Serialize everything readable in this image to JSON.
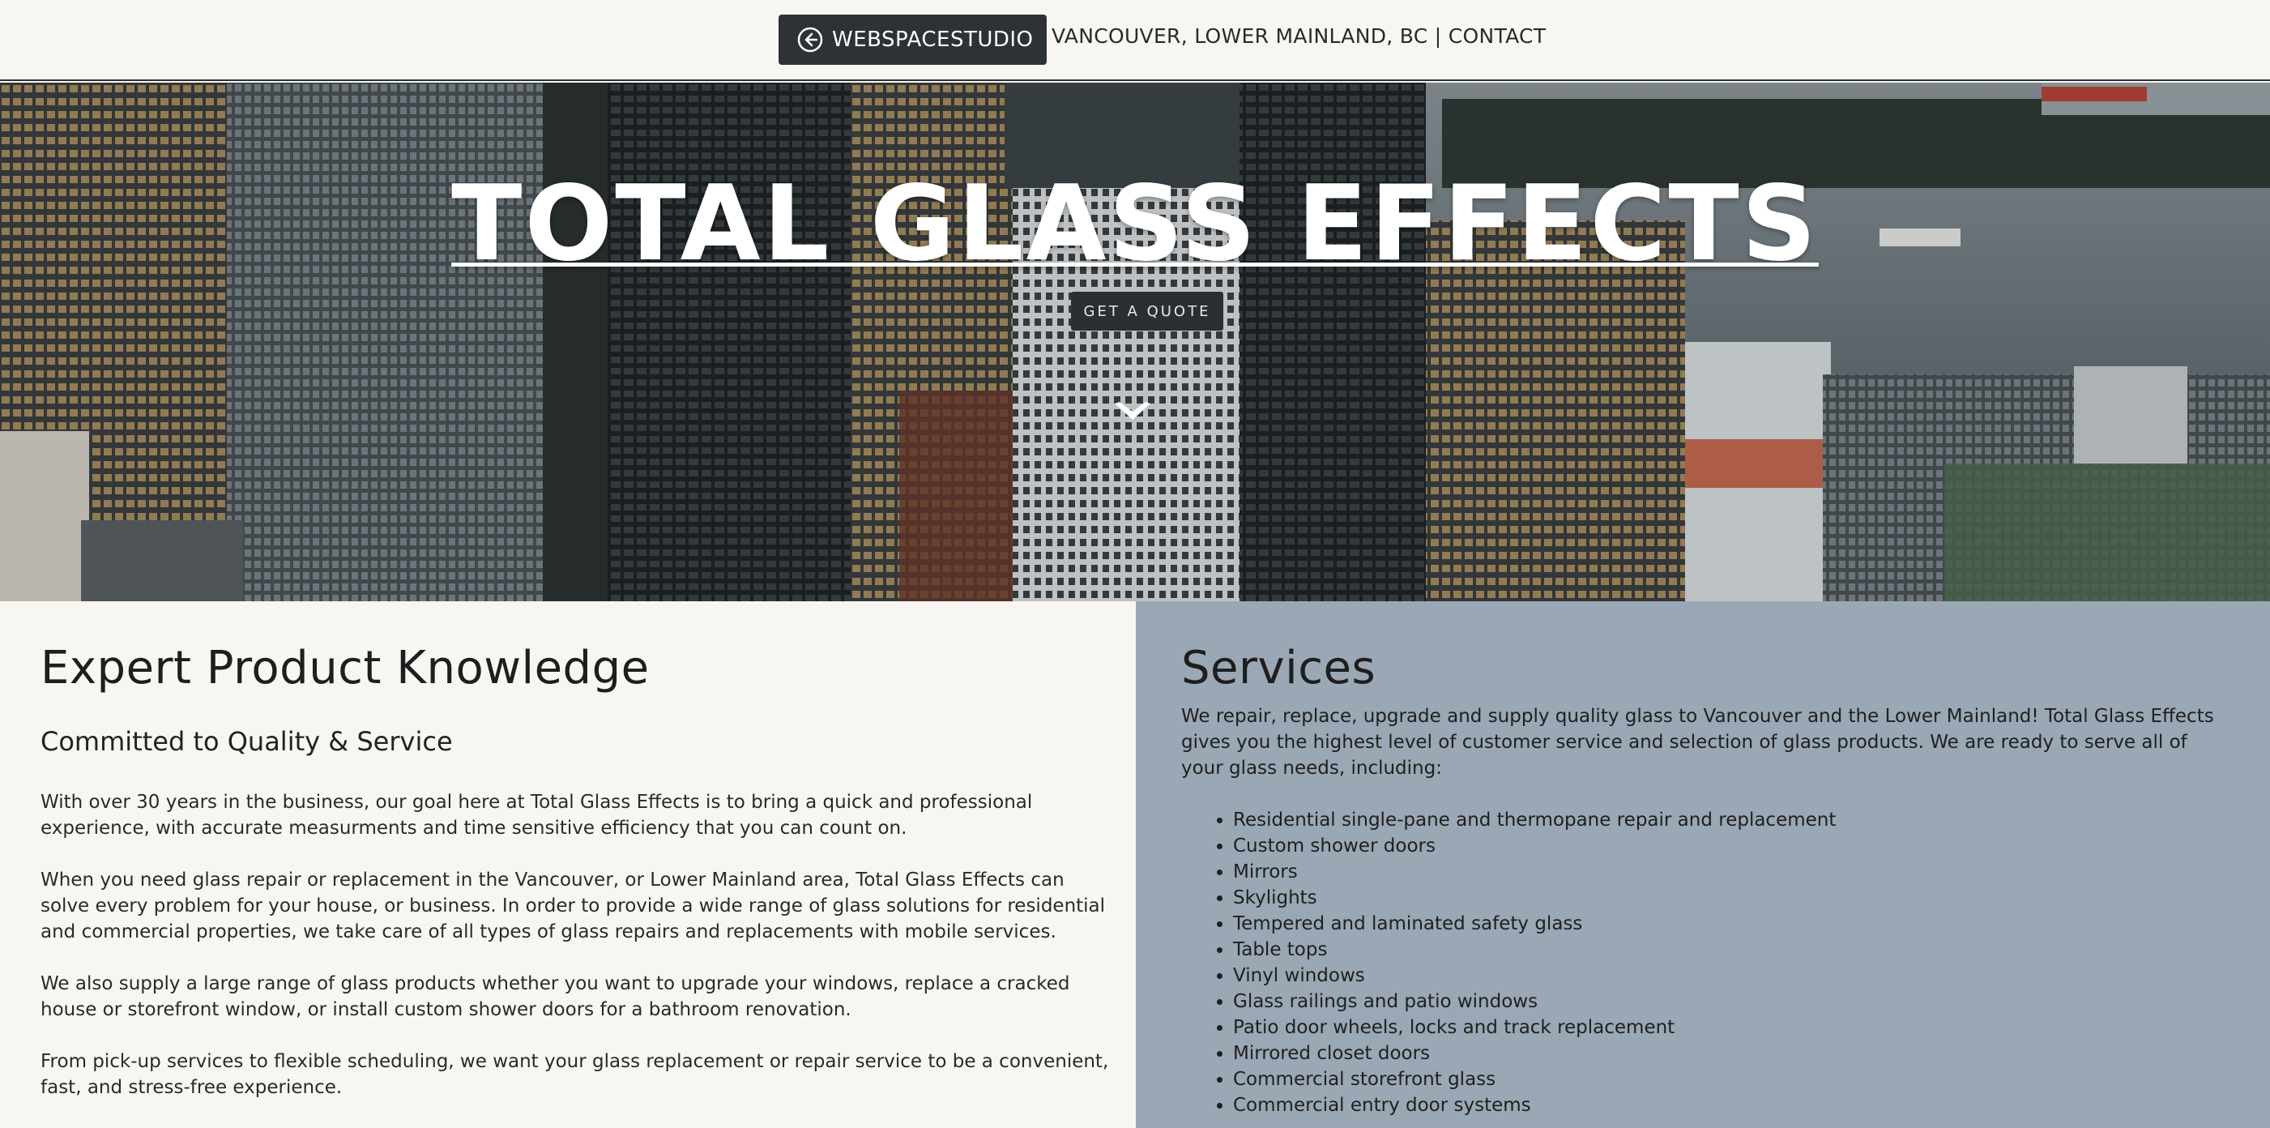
{
  "header": {
    "studio_label": "WEBSPACESTUDIO",
    "location_contact": "VANCOUVER, LOWER MAINLAND, BC | CONTACT"
  },
  "hero": {
    "title": "TOTAL GLASS EFFECTS",
    "cta_label": "GET A QUOTE"
  },
  "left": {
    "title": "Expert Product Knowledge",
    "subtitle": "Committed to Quality & Service",
    "paragraphs": [
      "With over 30 years in the business, our goal here at Total Glass Effects is to bring a quick and professional experience, with accurate measurments and time sensitive efficiency that you can count on.",
      "When you need glass repair or replacement in the Vancouver, or Lower Mainland area, Total Glass Effects can solve every problem for your house, or business. In order to provide a wide range of glass solutions for residential and commercial properties, we take care of all types of glass repairs and replacements with mobile services.",
      "We also supply a large range of glass products whether you want to upgrade your windows, replace a cracked house or storefront window, or install custom shower doors for a bathroom renovation.",
      "From pick-up services to flexible scheduling, we want your glass replacement or repair service to be a convenient, fast, and stress-free experience."
    ]
  },
  "right": {
    "title": "Services",
    "intro": "We repair, replace, upgrade and supply quality glass to Vancouver and the Lower Mainland! Total Glass Effects gives you the highest level of customer service and selection of glass products. We are ready to serve all of your glass needs, including:",
    "services": [
      "Residential single-pane and thermopane repair and replacement",
      "Custom shower doors",
      "Mirrors",
      "Skylights",
      "Tempered and laminated safety glass",
      "Table tops",
      "Vinyl windows",
      "Glass railings and patio windows",
      "Patio door wheels, locks and track replacement",
      "Mirrored closet doors",
      "Commercial storefront glass",
      "Commercial entry door systems"
    ]
  },
  "colors": {
    "background": "#f8f6f1",
    "dark_button": "#2e3236",
    "services_panel": "#9aa7b4"
  },
  "icons": {
    "back": "arrow-left-circle-icon",
    "scroll": "chevron-down-icon"
  }
}
